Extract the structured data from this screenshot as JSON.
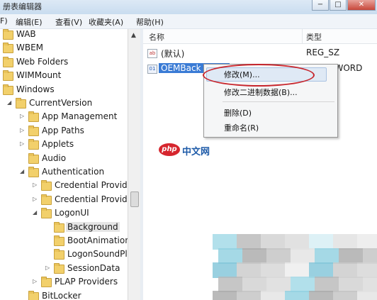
{
  "window": {
    "title": "册表编辑器",
    "controls": [
      "−",
      "□",
      "✕"
    ]
  },
  "menubar": [
    "F)",
    "编辑(E)",
    "查看(V)",
    "收藏夹(A)",
    "帮助(H)"
  ],
  "tree": [
    {
      "label": "WAB",
      "level": 0,
      "arrow": ""
    },
    {
      "label": "WBEM",
      "level": 0,
      "arrow": ""
    },
    {
      "label": "Web Folders",
      "level": 0,
      "arrow": ""
    },
    {
      "label": "WIMMount",
      "level": 0,
      "arrow": ""
    },
    {
      "label": "Windows",
      "level": 0,
      "arrow": ""
    },
    {
      "label": "CurrentVersion",
      "level": 1,
      "arrow": "◢"
    },
    {
      "label": "App Management",
      "level": 2,
      "arrow": "▷"
    },
    {
      "label": "App Paths",
      "level": 2,
      "arrow": "▷"
    },
    {
      "label": "Applets",
      "level": 2,
      "arrow": "▷"
    },
    {
      "label": "Audio",
      "level": 2,
      "arrow": ""
    },
    {
      "label": "Authentication",
      "level": 2,
      "arrow": "◢"
    },
    {
      "label": "Credential Provide",
      "level": 3,
      "arrow": "▷"
    },
    {
      "label": "Credential Provide",
      "level": 3,
      "arrow": "▷"
    },
    {
      "label": "LogonUI",
      "level": 3,
      "arrow": "◢"
    },
    {
      "label": "Background",
      "level": 4,
      "arrow": "",
      "selected": true
    },
    {
      "label": "BootAnimation",
      "level": 4,
      "arrow": ""
    },
    {
      "label": "LogonSoundPla",
      "level": 4,
      "arrow": ""
    },
    {
      "label": "SessionData",
      "level": 4,
      "arrow": "▷"
    },
    {
      "label": "PLAP Providers",
      "level": 3,
      "arrow": "▷"
    },
    {
      "label": "BitLocker",
      "level": 2,
      "arrow": ""
    }
  ],
  "list": {
    "headers": {
      "name": "名称",
      "type": "类型"
    },
    "rows": [
      {
        "icon": "ab",
        "name": "(默认)",
        "type": "REG_SZ",
        "selected": false
      },
      {
        "icon": "01",
        "name": "OEMBack",
        "type": "REG_DWORD",
        "selected": true
      }
    ]
  },
  "context_menu": {
    "items": [
      "修改(M)...",
      "修改二进制数据(B)...",
      "删除(D)",
      "重命名(R)"
    ],
    "highlighted": 0
  },
  "watermark": {
    "logo": "php",
    "text": "中文网"
  },
  "colors": {
    "selection": "#3a7bd5",
    "annotation": "#c7252c",
    "folder": "#f2d06b"
  }
}
